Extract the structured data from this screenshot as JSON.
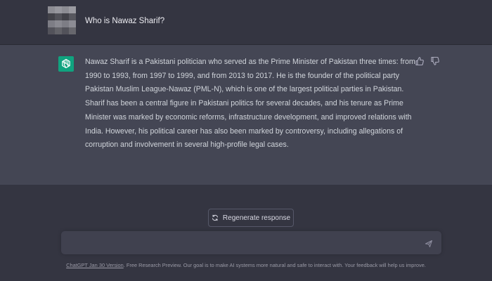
{
  "user_message": {
    "text": "Who is Nawaz Sharif?"
  },
  "assistant_message": {
    "text": "Nawaz Sharif is a Pakistani politician who served as the Prime Minister of Pakistan three times: from 1990 to 1993, from 1997 to 1999, and from 2013 to 2017. He is the founder of the political party Pakistan Muslim League-Nawaz (PML-N), which is one of the largest political parties in Pakistan. Sharif has been a central figure in Pakistani politics for several decades, and his tenure as Prime Minister was marked by economic reforms, infrastructure development, and improved relations with India. However, his political career has also been marked by controversy, including allegations of corruption and involvement in several high-profile legal cases.",
    "feedback_icons": [
      "thumbs-up-icon",
      "thumbs-down-icon"
    ]
  },
  "regenerate": {
    "label": "Regenerate response",
    "icon": "refresh-icon"
  },
  "input": {
    "value": "",
    "placeholder": "",
    "send_icon": "send-icon"
  },
  "footer": {
    "version_link": "ChatGPT Jan 30 Version",
    "text": ". Free Research Preview. Our goal is to make AI systems more natural and safe to interact with. Your feedback will help us improve."
  },
  "colors": {
    "background": "#343541",
    "assistant_background": "#444654",
    "brand_green": "#10a37f",
    "input_background": "#40414f"
  }
}
